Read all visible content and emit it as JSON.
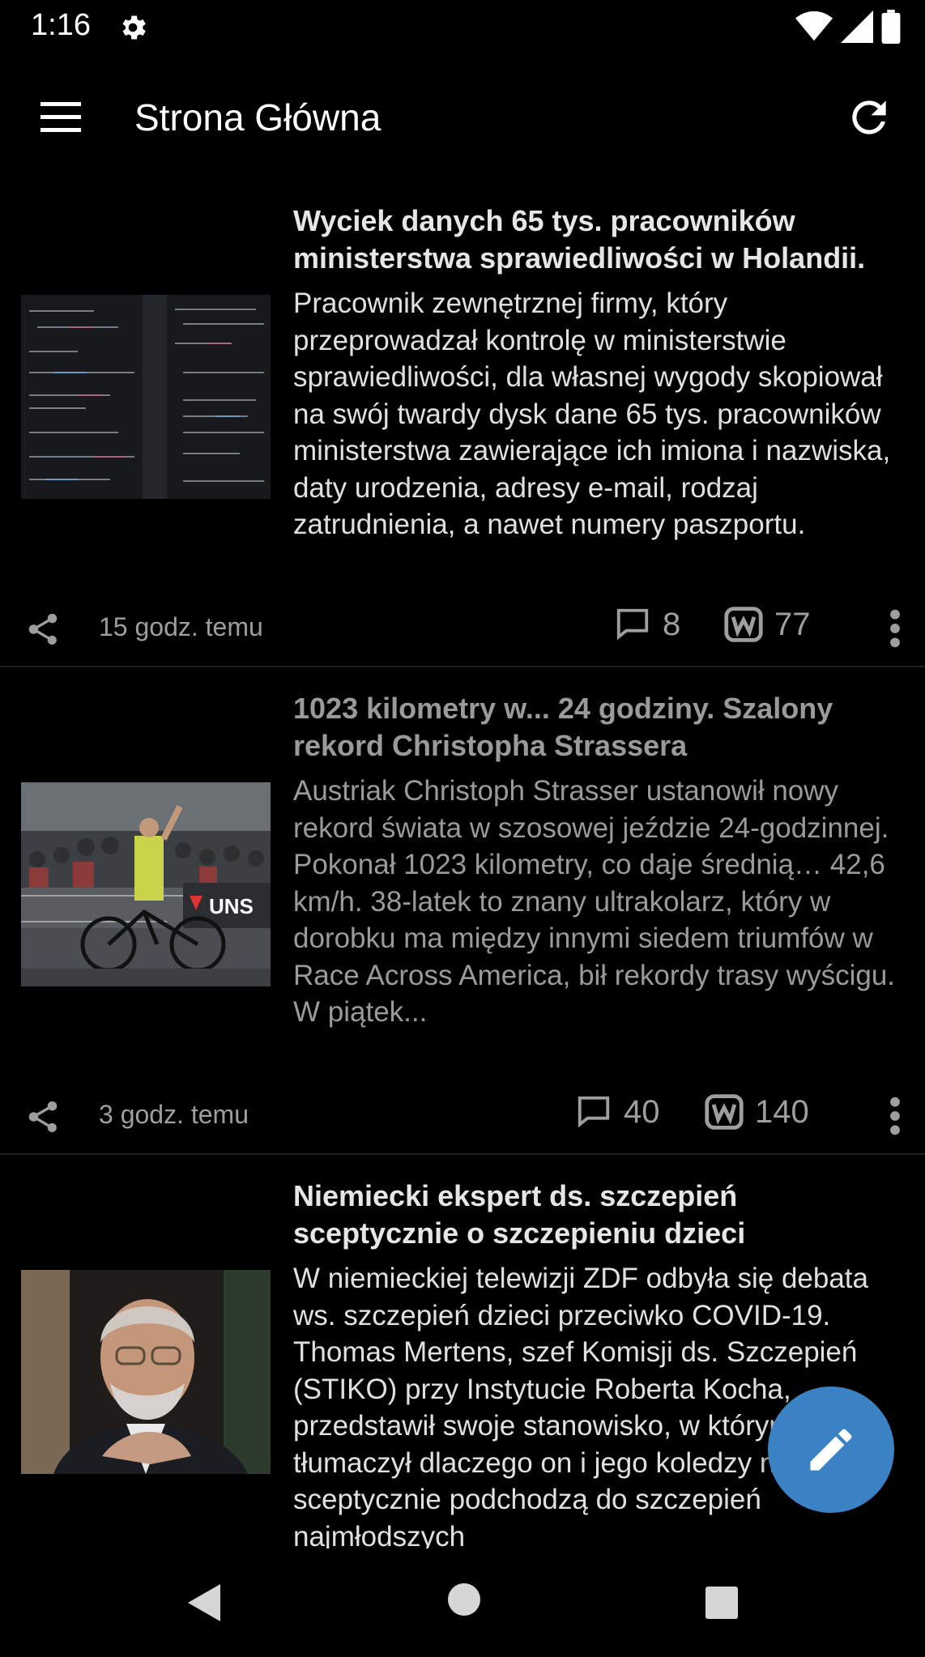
{
  "status_bar": {
    "time": "1:16",
    "settings_icon": "gear-icon",
    "wifi_icon": "wifi-icon",
    "signal_icon": "signal-icon",
    "battery_icon": "battery-icon"
  },
  "app_bar": {
    "title": "Strona Główna",
    "menu_icon": "hamburger-menu-icon",
    "refresh_icon": "refresh-icon"
  },
  "articles": [
    {
      "title": "Wyciek danych 65 tys. pracowników ministerstwa sprawiedliwości w Holandii.",
      "body": "Pracownik zewnętrznej firmy, który przeprowadzał kontrolę w ministerstwie sprawiedliwości, dla własnej wygody skopiował na swój twardy dysk dane 65 tys. pracowników ministerstwa zawierające ich imiona i nazwiska, daty urodzenia, adresy e-mail, rodzaj zatrudnienia, a nawet numery paszportu.",
      "time": "15 godz. temu",
      "comments": "8",
      "votes": "77",
      "read": false
    },
    {
      "title": "1023 kilometry w... 24 godziny. Szalony rekord Christopha Strassera",
      "body": "Austriak Christoph Strasser ustanowił nowy rekord świata w szosowej jeździe 24-godzinnej. Pokonał 1023 kilometry, co daje średnią… 42,6 km/h. 38-latek to znany ultrakolarz, który w dorobku ma między innymi siedem triumfów w Race Across America, bił rekordy trasy wyścigu. W piątek...",
      "time": "3 godz. temu",
      "comments": "40",
      "votes": "140",
      "read": true,
      "image_text": "UNS"
    },
    {
      "title": "Niemiecki ekspert ds. szczepień sceptycznie o szczepieniu dzieci",
      "body": "W niemieckiej telewizji ZDF odbyła się debata ws. szczepień dzieci przeciwko COVID-19. Thomas Mertens, szef Komisji ds. Szczepień (STIKO) przy Instytucie Roberta Kocha, przedstawił swoje stanowisko, w którym tłumaczył dlaczego on i jego koledzy nadal sceptycznie podchodzą do szczepień najmłodszych",
      "read": false
    }
  ],
  "fab": {
    "icon": "pencil-icon"
  },
  "nav_bar": {
    "back_icon": "back-triangle-icon",
    "home_icon": "home-circle-icon",
    "recent_icon": "recents-square-icon"
  },
  "colors": {
    "background": "#000000",
    "fab": "#3b82c4",
    "muted_text": "#9e9e9e",
    "read_text": "#9a9a9a"
  }
}
